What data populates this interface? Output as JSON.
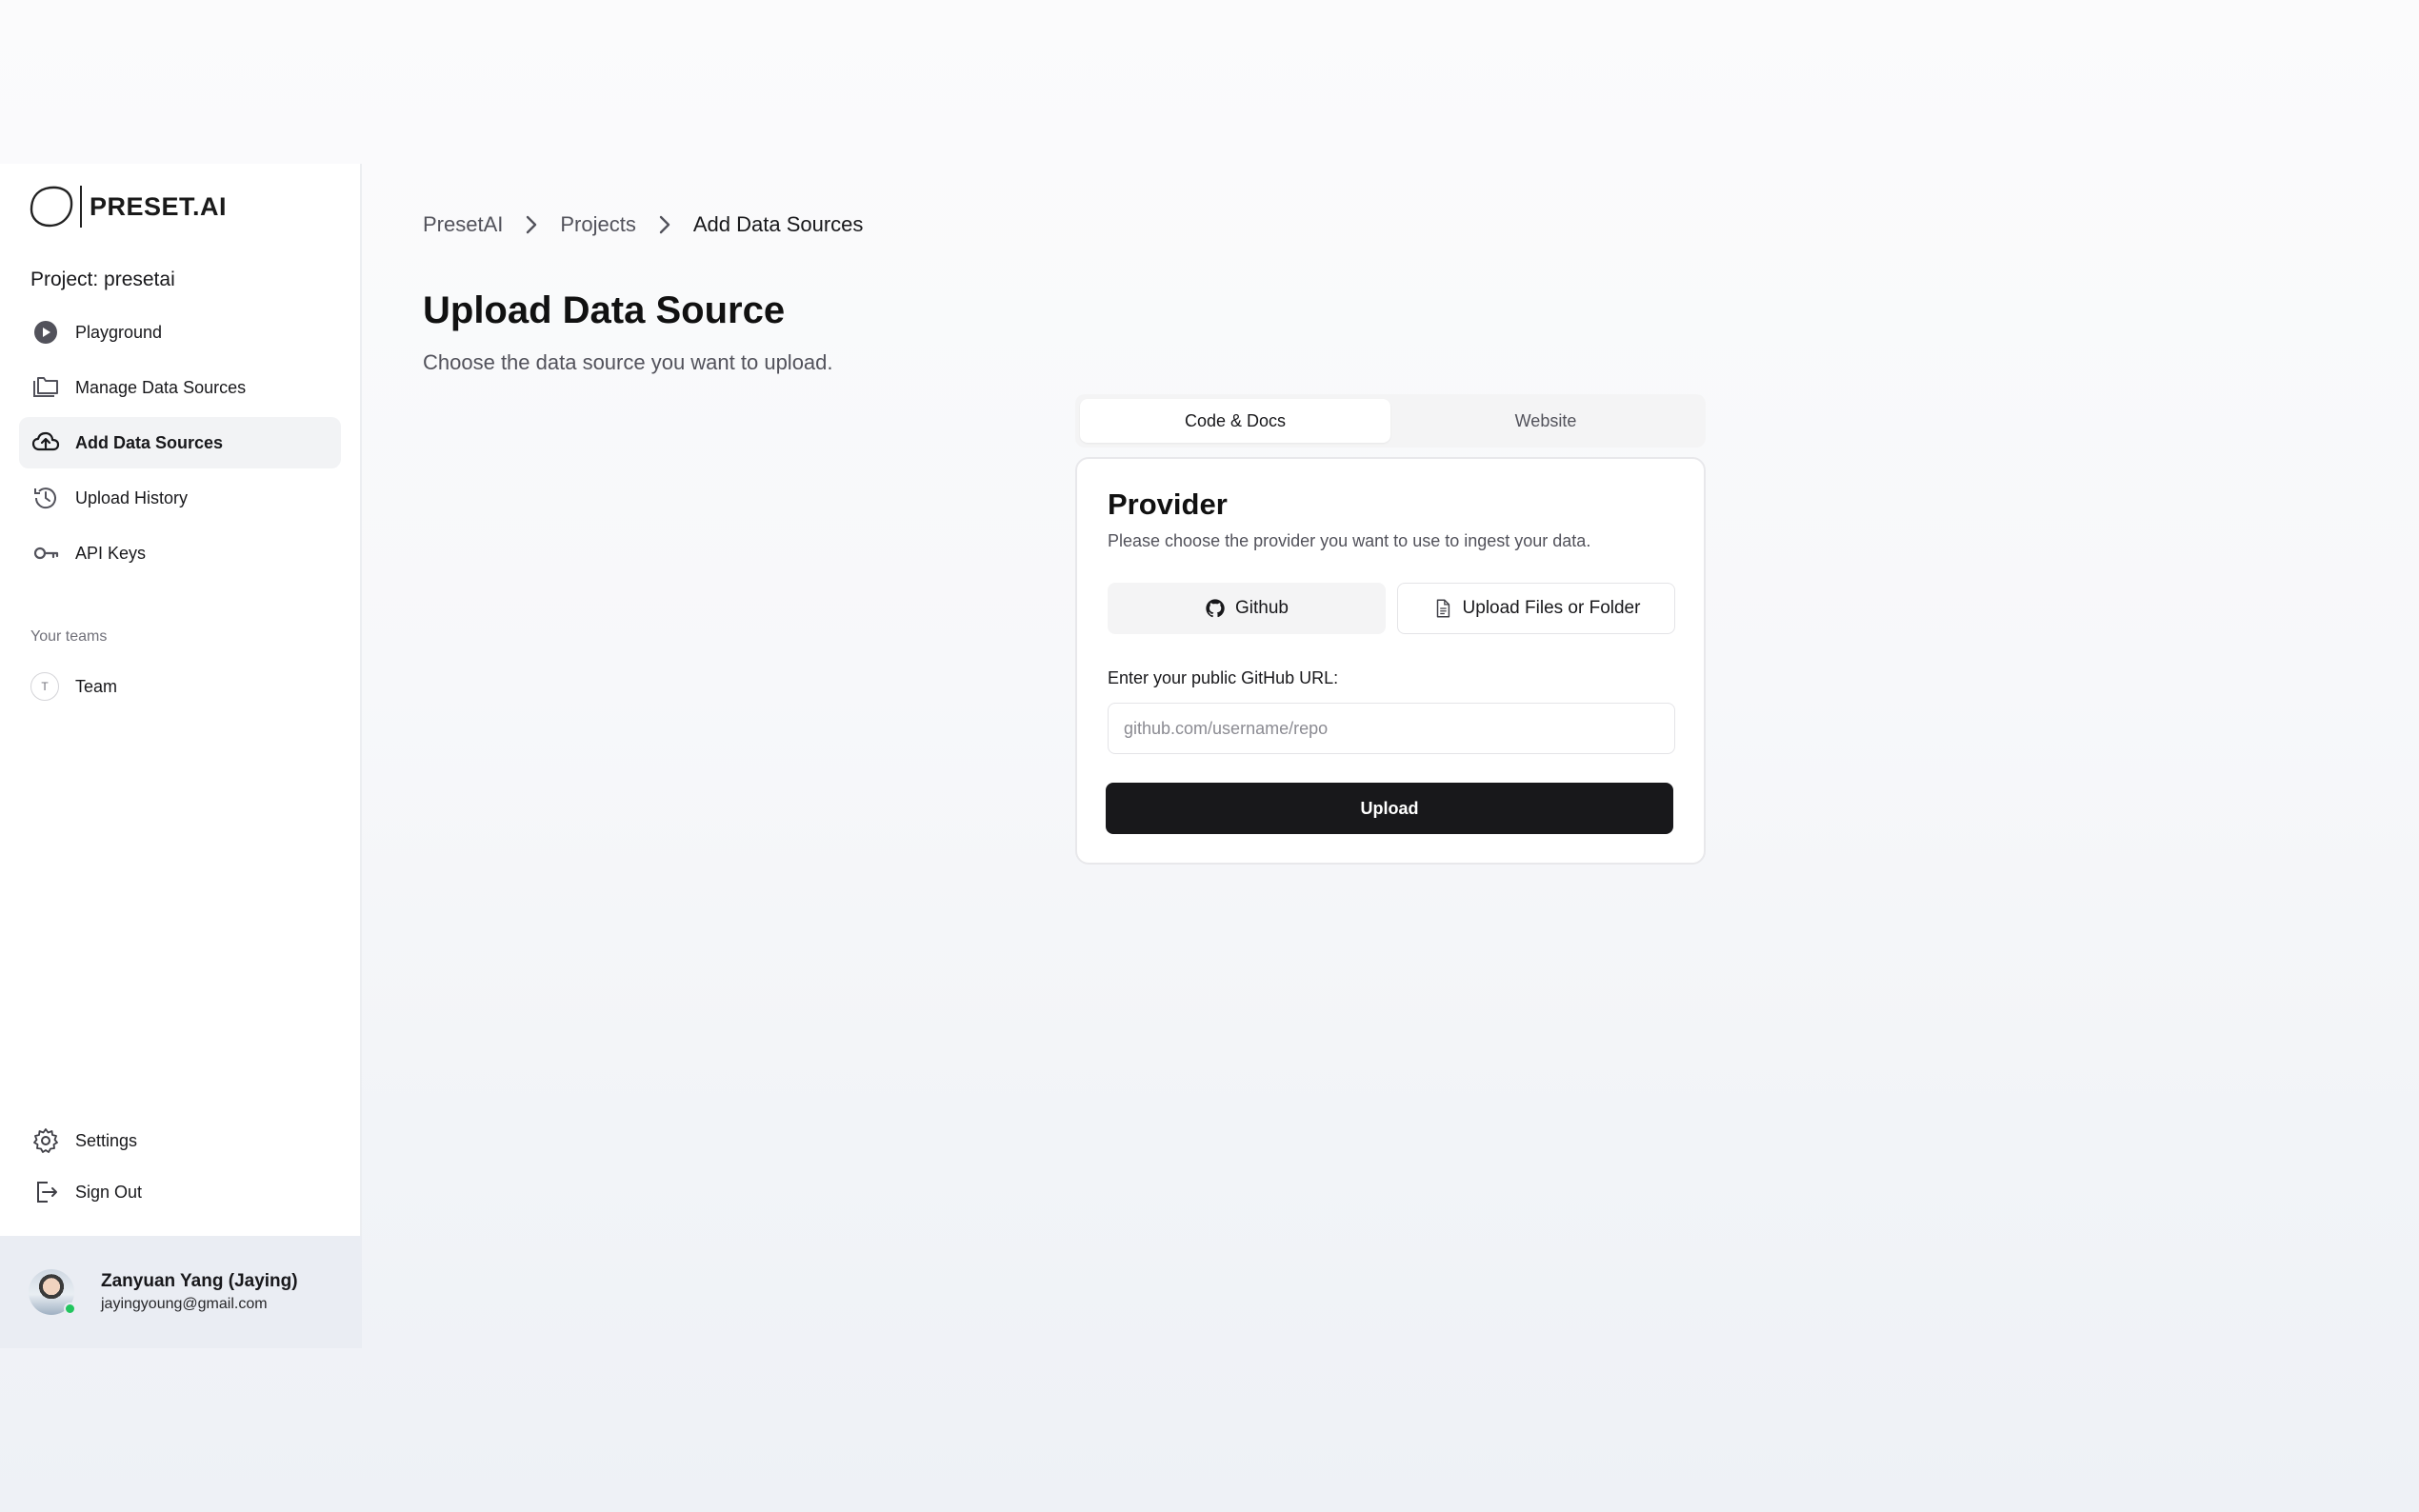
{
  "brand": {
    "name": "PRESET.AI",
    "logo_icon": "blob-outline-icon"
  },
  "project": {
    "label": "Project: presetai"
  },
  "sidebar": {
    "items": [
      {
        "label": "Playground",
        "icon": "play-circle-icon"
      },
      {
        "label": "Manage Data Sources",
        "icon": "folders-icon"
      },
      {
        "label": "Add Data Sources",
        "icon": "cloud-upload-icon",
        "active": true
      },
      {
        "label": "Upload History",
        "icon": "history-icon"
      },
      {
        "label": "API Keys",
        "icon": "key-icon"
      }
    ],
    "teams_heading": "Your teams",
    "teams": [
      {
        "initial": "T",
        "label": "Team"
      }
    ],
    "bottom_items": [
      {
        "label": "Settings",
        "icon": "gear-icon"
      },
      {
        "label": "Sign Out",
        "icon": "sign-out-icon"
      }
    ],
    "user": {
      "name": "Zanyuan Yang (Jaying)",
      "email": "jayingyoung@gmail.com",
      "status": "online"
    }
  },
  "breadcrumb": [
    {
      "label": "PresetAI"
    },
    {
      "label": "Projects"
    },
    {
      "label": "Add Data Sources",
      "current": true
    }
  ],
  "page": {
    "title": "Upload Data Source",
    "subtitle": "Choose the data source you want to upload."
  },
  "tabs": [
    {
      "label": "Code & Docs",
      "active": true
    },
    {
      "label": "Website",
      "active": false
    }
  ],
  "provider_card": {
    "title": "Provider",
    "description": "Please choose the provider you want to use to ingest your data.",
    "options": [
      {
        "label": "Github",
        "icon": "github-icon",
        "selected": true
      },
      {
        "label": "Upload Files or Folder",
        "icon": "file-icon",
        "selected": false
      }
    ],
    "url_label": "Enter your public GitHub URL:",
    "url_value": "",
    "url_placeholder": "github.com/username/repo",
    "submit_label": "Upload"
  },
  "colors": {
    "primary_button": "#18181b",
    "active_nav_bg": "#f2f3f5",
    "online": "#22c55e"
  }
}
